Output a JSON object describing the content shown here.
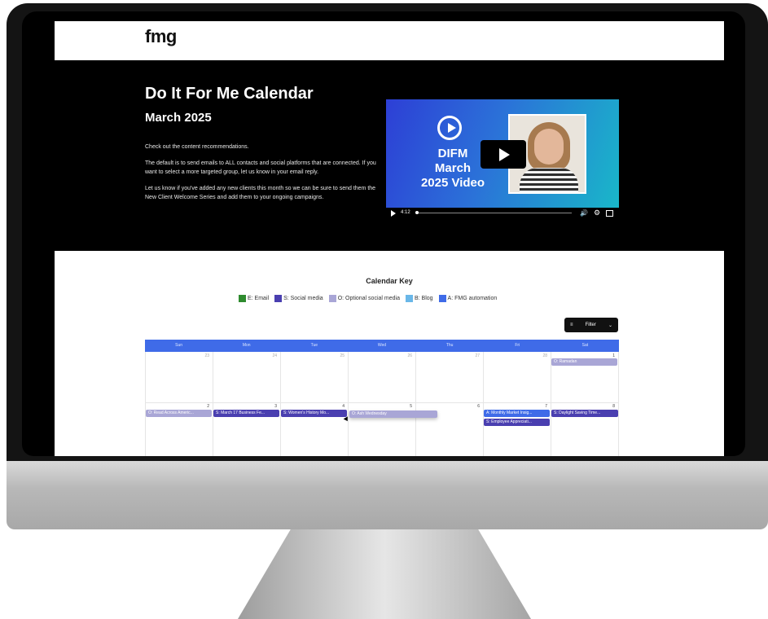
{
  "header": {
    "logo": "fmg"
  },
  "hero": {
    "title": "Do It For Me Calendar",
    "subtitle": "March 2025",
    "paragraphs": [
      "Check out the content recommendations.",
      "The default is to send emails to ALL contacts and social platforms that are connected. If you want to select a more targeted group, let us know in your email reply.",
      "Let us know if you've added any new clients this month so we can be sure to send them the New Client Welcome Series and add them to your ongoing campaigns."
    ]
  },
  "video": {
    "caption_lines": [
      "DIFM",
      "March",
      "2025 Video"
    ],
    "time": "4:12",
    "icons": [
      "play-circle-icon",
      "play-icon",
      "volume-icon",
      "settings-icon",
      "fullscreen-icon"
    ]
  },
  "calendar_key": {
    "title": "Calendar Key",
    "items": [
      {
        "label": "E: Email",
        "color": "#2e8b2e"
      },
      {
        "label": "S: Social media",
        "color": "#4a3fb0"
      },
      {
        "label": "O: Optional social media",
        "color": "#a9a6d6"
      },
      {
        "label": "B: Blog",
        "color": "#6ab7e8"
      },
      {
        "label": "A: FMG automation",
        "color": "#3f6be8"
      }
    ]
  },
  "filter": {
    "label": "Filter"
  },
  "calendar": {
    "weekdays": [
      "Sun",
      "Mon",
      "Tue",
      "Wed",
      "Thu",
      "Fri",
      "Sat"
    ],
    "weeks": [
      {
        "days": [
          "23",
          "24",
          "25",
          "26",
          "27",
          "28",
          "1"
        ]
      },
      {
        "days": [
          "2",
          "3",
          "4",
          "5",
          "6",
          "7",
          "8"
        ]
      }
    ],
    "events": [
      {
        "label": "O: Ramadan",
        "color": "#a9a6d6"
      },
      {
        "label": "O: Read Across Americ...",
        "color": "#a9a6d6"
      },
      {
        "label": "S: March 17 Business Fe...",
        "color": "#4a3fb0"
      },
      {
        "label": "S: Women's History Mo...",
        "color": "#4a3fb0"
      },
      {
        "label": "O: Ash Wednesday",
        "color": "#a9a6d6"
      },
      {
        "label": "A: Monthly Market Insig...",
        "color": "#3f6be8"
      },
      {
        "label": "S: Employee Appreciati...",
        "color": "#4a3fb0"
      },
      {
        "label": "S: Daylight Saving Time...",
        "color": "#4a3fb0"
      }
    ]
  }
}
